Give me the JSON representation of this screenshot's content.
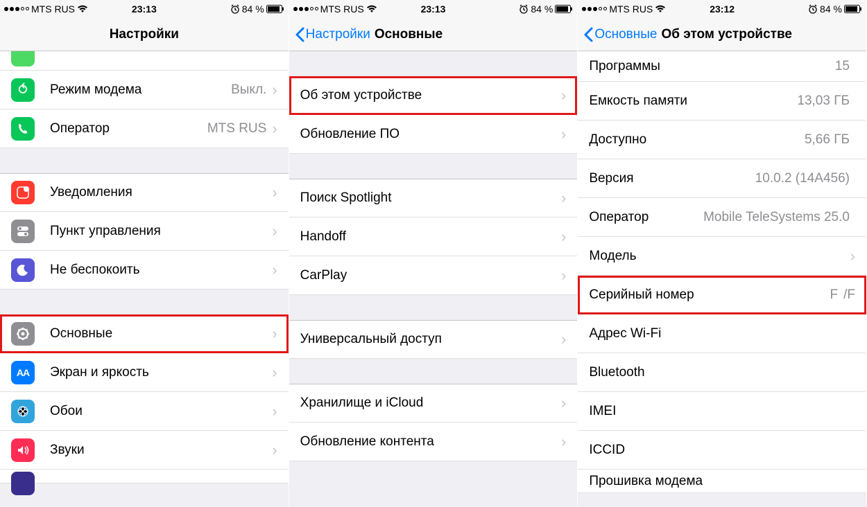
{
  "status": {
    "carrier": "MTS RUS",
    "time1": "23:13",
    "time2": "23:13",
    "time3": "23:12",
    "battery": "84 %"
  },
  "screen1": {
    "title": "Настройки",
    "rows": {
      "hotspot": {
        "label": "Режим модема",
        "value": "Выкл."
      },
      "carrier": {
        "label": "Оператор",
        "value": "MTS RUS"
      },
      "notifications": {
        "label": "Уведомления"
      },
      "control": {
        "label": "Пункт управления"
      },
      "dnd": {
        "label": "Не беспокоить"
      },
      "general": {
        "label": "Основные"
      },
      "display": {
        "label": "Экран и яркость"
      },
      "wallpaper": {
        "label": "Обои"
      },
      "sounds": {
        "label": "Звуки"
      }
    }
  },
  "screen2": {
    "back": "Настройки",
    "title": "Основные",
    "rows": {
      "about": {
        "label": "Об этом устройстве"
      },
      "swupdate": {
        "label": "Обновление ПО"
      },
      "spotlight": {
        "label": "Поиск Spotlight"
      },
      "handoff": {
        "label": "Handoff"
      },
      "carplay": {
        "label": "CarPlay"
      },
      "accessibility": {
        "label": "Универсальный доступ"
      },
      "storage": {
        "label": "Хранилище и iCloud"
      },
      "refresh": {
        "label": "Обновление контента"
      }
    }
  },
  "screen3": {
    "back": "Основные",
    "title": "Об этом устройстве",
    "rows": {
      "apps": {
        "label": "Программы",
        "value": "15"
      },
      "capacity": {
        "label": "Емкость памяти",
        "value": "13,03 ГБ"
      },
      "available": {
        "label": "Доступно",
        "value": "5,66 ГБ"
      },
      "version": {
        "label": "Версия",
        "value": "10.0.2 (14A456)"
      },
      "carrier": {
        "label": "Оператор",
        "value": "Mobile TeleSystems 25.0"
      },
      "model": {
        "label": "Модель",
        "value": ""
      },
      "serial": {
        "label": "Серийный номер",
        "value": "F",
        "value2": "/F"
      },
      "wifi": {
        "label": "Адрес Wi-Fi",
        "value": ""
      },
      "bluetooth": {
        "label": "Bluetooth",
        "value": ""
      },
      "imei": {
        "label": "IMEI",
        "value": ""
      },
      "iccid": {
        "label": "ICCID",
        "value": ""
      },
      "modem": {
        "label": "Прошивка модема",
        "value": ""
      }
    }
  }
}
